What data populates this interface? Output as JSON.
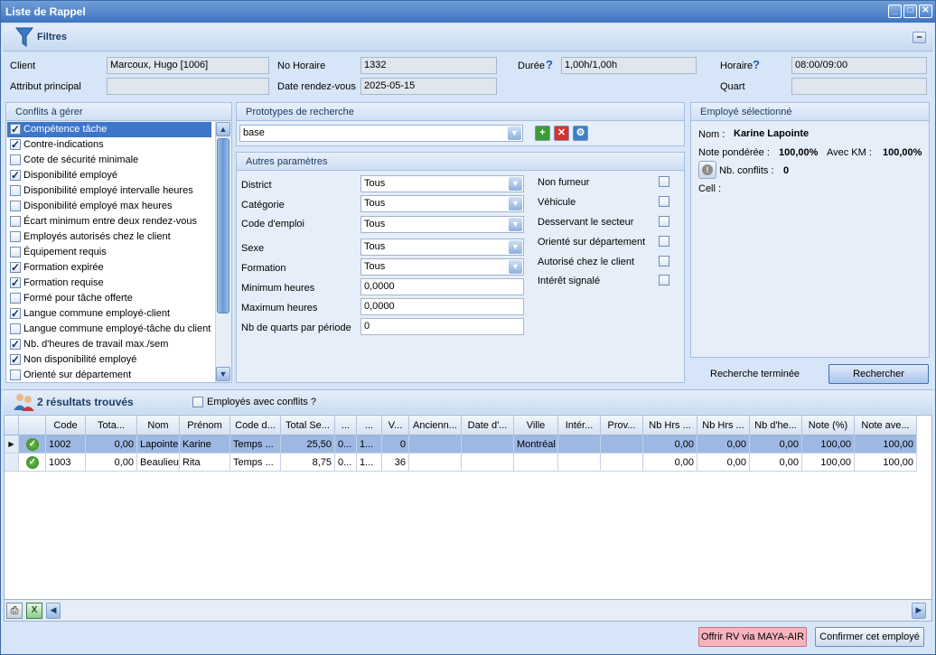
{
  "window": {
    "title": "Liste de Rappel"
  },
  "filters": {
    "title": "Filtres"
  },
  "header": {
    "client_label": "Client",
    "client_value": "Marcoux, Hugo  [1006]",
    "attribut_label": "Attribut principal",
    "attribut_value": "",
    "no_horaire_label": "No Horaire",
    "no_horaire_value": "1332",
    "date_label": "Date rendez-vous",
    "date_value": "2025-05-15",
    "duree_label": "Durée",
    "duree_value": "1,00h/1,00h",
    "horaire_label": "Horaire",
    "horaire_value": "08:00/09:00",
    "quart_label": "Quart",
    "quart_value": ""
  },
  "conflicts": {
    "title": "Conflits à gérer",
    "items": [
      {
        "label": "Compétence tâche",
        "checked": true,
        "selected": true
      },
      {
        "label": "Contre-indications",
        "checked": true
      },
      {
        "label": "Cote de sécurité minimale",
        "checked": false
      },
      {
        "label": "Disponibilité employé",
        "checked": true
      },
      {
        "label": "Disponibilité employé intervalle heures",
        "checked": false
      },
      {
        "label": "Disponibilité employé max heures",
        "checked": false
      },
      {
        "label": "Écart minimum entre deux rendez-vous",
        "checked": false
      },
      {
        "label": "Employés autorisés chez le client",
        "checked": false
      },
      {
        "label": "Équipement requis",
        "checked": false
      },
      {
        "label": "Formation expirée",
        "checked": true
      },
      {
        "label": "Formation requise",
        "checked": true
      },
      {
        "label": "Formé pour tâche offerte",
        "checked": false
      },
      {
        "label": "Langue commune employé-client",
        "checked": true
      },
      {
        "label": "Langue commune employé-tâche du client",
        "checked": false
      },
      {
        "label": "Nb. d'heures de travail max./sem",
        "checked": true
      },
      {
        "label": "Non disponibilité employé",
        "checked": true
      },
      {
        "label": "Orienté sur département",
        "checked": false
      }
    ]
  },
  "prototypes": {
    "title": "Prototypes de recherche",
    "value": "base"
  },
  "params": {
    "title": "Autres paramètres",
    "district_label": "District",
    "district_value": "Tous",
    "categorie_label": "Catégorie",
    "categorie_value": "Tous",
    "code_emploi_label": "Code d'emploi",
    "code_emploi_value": "Tous",
    "sexe_label": "Sexe",
    "sexe_value": "Tous",
    "formation_label": "Formation",
    "formation_value": "Tous",
    "min_heures_label": "Minimum heures",
    "min_heures_value": "0,0000",
    "max_heures_label": "Maximum heures",
    "max_heures_value": "0,0000",
    "nb_quarts_label": "Nb de quarts par période",
    "nb_quarts_value": "0",
    "non_fumeur": "Non fumeur",
    "vehicule": "Véhicule",
    "desservant": "Desservant le secteur",
    "oriente": "Orienté sur département",
    "autorise": "Autorisé chez le client",
    "interet": "Intérêt signalé"
  },
  "employee": {
    "title": "Employé sélectionné",
    "nom_label": "Nom :",
    "nom_value": "Karine Lapointe",
    "note_label": "Note pondérée :",
    "note_value": "100,00%",
    "km_label": "Avec KM :",
    "km_value": "100,00%",
    "conflits_label": "Nb. conflits :",
    "conflits_value": "0",
    "cell_label": "Cell :"
  },
  "search": {
    "status": "Recherche terminée",
    "button": "Rechercher"
  },
  "results": {
    "count_label": "2 résultats trouvés",
    "with_conflicts_label": "Employés avec conflits ?"
  },
  "grid": {
    "headers": [
      "Code",
      "Tota...",
      "Nom",
      "Prénom",
      "Code d...",
      "Total Se...",
      "...",
      "...",
      "V...",
      "Ancienn...",
      "Date d'...",
      "Ville",
      "Intér...",
      "Prov...",
      "Nb Hrs ...",
      "Nb Hrs ...",
      "Nb d'he...",
      "Note (%)",
      "Note ave..."
    ],
    "rows": [
      [
        "1002",
        "0,00",
        "Lapointe",
        "Karine",
        "Temps ...",
        "25,50",
        "0...",
        "1...",
        "0",
        "",
        "",
        "Montréal",
        "",
        "",
        "0,00",
        "0,00",
        "0,00",
        "100,00",
        "100,00"
      ],
      [
        "1003",
        "0,00",
        "Beaulieu",
        "Rita",
        "Temps ...",
        "8,75",
        "0...",
        "1...",
        "36",
        "",
        "",
        "",
        "",
        "",
        "0,00",
        "0,00",
        "0,00",
        "100,00",
        "100,00"
      ]
    ]
  },
  "footer": {
    "offer_button": "Offrir RV via MAYA-AIR",
    "confirm_button": "Confirmer cet employé"
  },
  "colors": {
    "title_bar": "#3f74c0",
    "selection": "#3d76c9",
    "offer_button": "#f7b4bd"
  }
}
